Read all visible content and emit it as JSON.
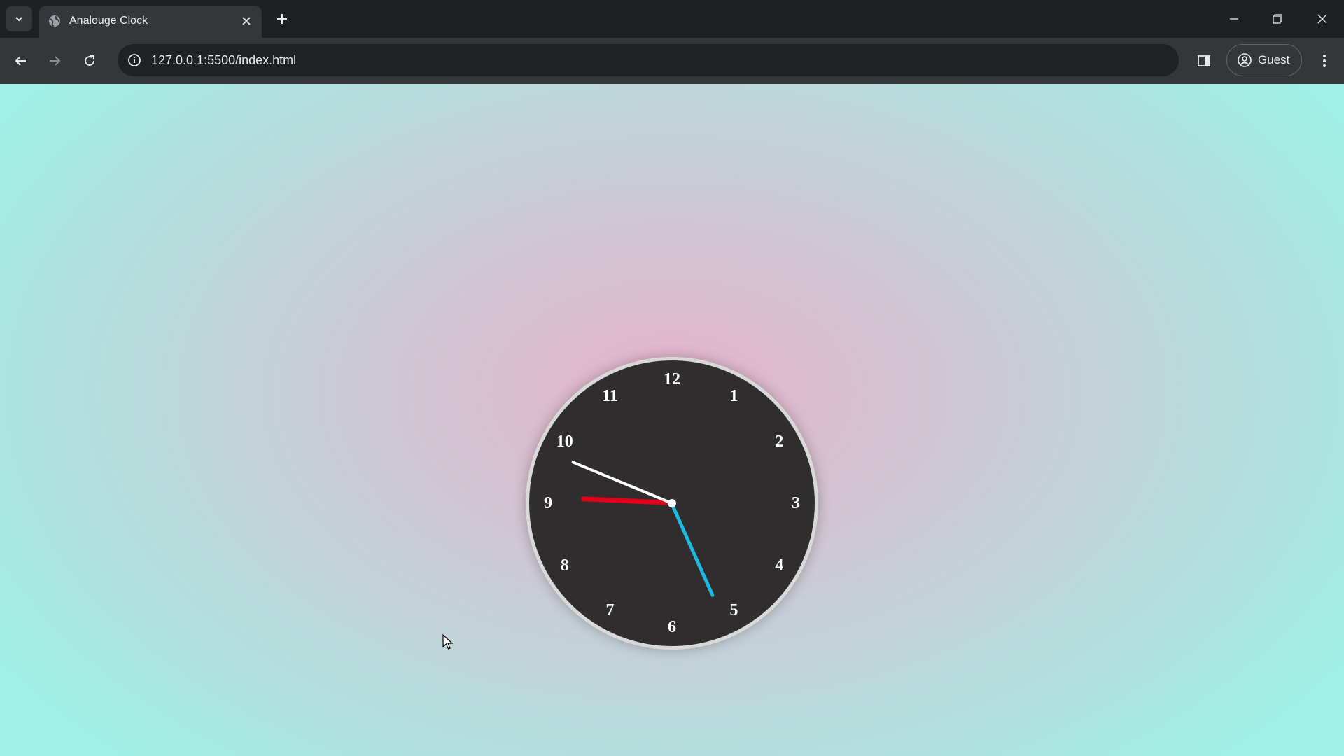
{
  "browser": {
    "tab": {
      "title": "Analouge Clock",
      "favicon": "globe-icon"
    },
    "address": {
      "url": "127.0.0.1:5500/index.html"
    },
    "profile": {
      "label": "Guest"
    },
    "icons": {
      "tab_search": "chevron-down-icon",
      "close_tab": "close-icon",
      "new_tab": "plus-icon",
      "minimize": "minimize-icon",
      "restore": "restore-icon",
      "close_window": "close-icon",
      "back": "arrow-left-icon",
      "forward": "arrow-right-icon",
      "reload": "reload-icon",
      "site_info": "info-icon",
      "side_panel": "side-panel-icon",
      "menu": "kebab-menu-icon"
    }
  },
  "clock": {
    "numerals": [
      "12",
      "1",
      "2",
      "3",
      "4",
      "5",
      "6",
      "7",
      "8",
      "9",
      "10",
      "11"
    ],
    "time": {
      "hour": 9,
      "minute": 45,
      "second": 26
    },
    "colors": {
      "face": "#2f2d2e",
      "rim": "#d9d9d9",
      "hour_hand": "#ffffff",
      "minute_hand": "#e0001a",
      "second_hand": "#1fb8e0"
    }
  }
}
